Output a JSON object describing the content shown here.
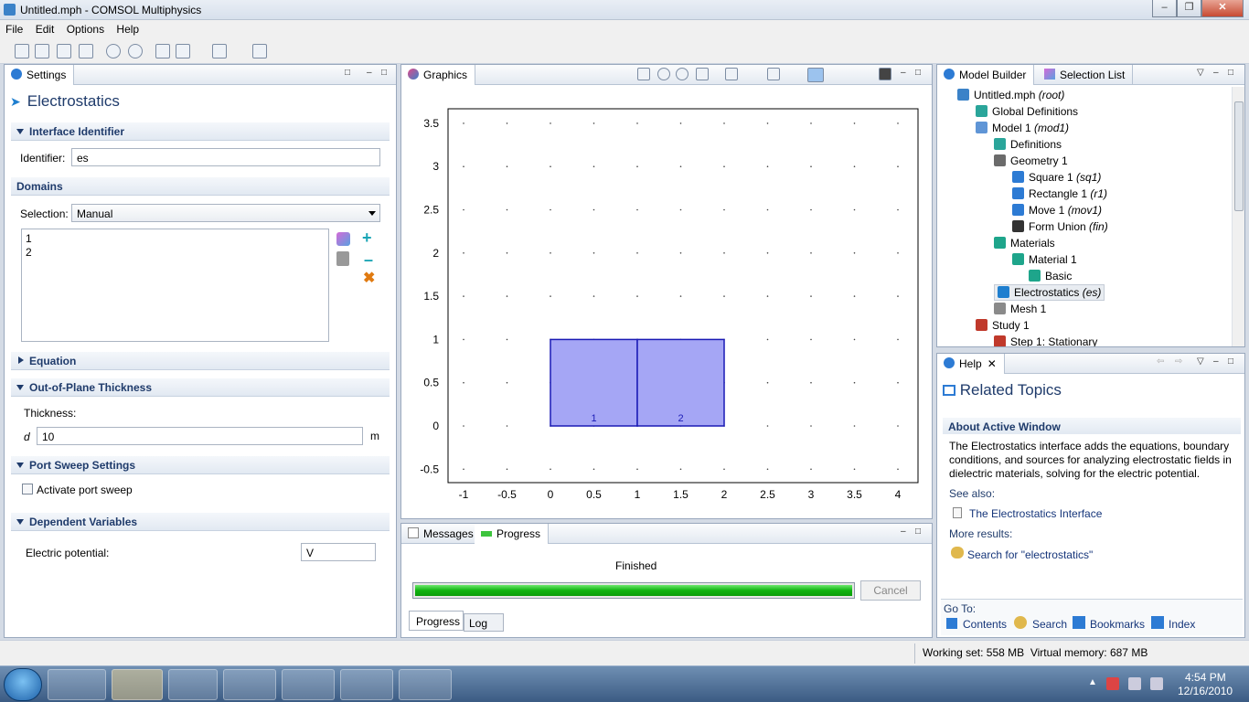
{
  "window": {
    "title": "Untitled.mph - COMSOL Multiphysics"
  },
  "menu": [
    "File",
    "Edit",
    "Options",
    "Help"
  ],
  "settings": {
    "tab_label": "Settings",
    "heading": "Electrostatics",
    "interface_identifier": {
      "title": "Interface Identifier",
      "label": "Identifier:",
      "value": "es"
    },
    "domains": {
      "title": "Domains",
      "selection_label": "Selection:",
      "selection_value": "Manual",
      "items": [
        "1",
        "2"
      ]
    },
    "equation": {
      "title": "Equation"
    },
    "thickness": {
      "title": "Out-of-Plane Thickness",
      "label": "Thickness:",
      "symbol": "d",
      "value": "10",
      "unit": "m"
    },
    "port_sweep": {
      "title": "Port Sweep Settings",
      "checkbox_label": "Activate port sweep"
    },
    "dependent": {
      "title": "Dependent Variables",
      "label": "Electric potential:",
      "value": "V"
    }
  },
  "graphics": {
    "tab_label": "Graphics",
    "x_ticks": [
      "-1",
      "-0.5",
      "0",
      "0.5",
      "1",
      "1.5",
      "2",
      "2.5",
      "3",
      "3.5",
      "4"
    ],
    "y_ticks": [
      "3.5",
      "3",
      "2.5",
      "2",
      "1.5",
      "1",
      "0.5",
      "0",
      "-0.5"
    ],
    "domain_labels": [
      "1",
      "2"
    ],
    "fill_color": "#a5a6f5",
    "edge_color": "#1a1ab5"
  },
  "messages": {
    "tabs": [
      "Messages",
      "Progress"
    ],
    "status": "Finished",
    "progress": 1.0,
    "cancel_label": "Cancel",
    "bottom_tabs": [
      "Progress",
      "Log"
    ]
  },
  "model_builder": {
    "tabs": [
      "Model Builder",
      "Selection List"
    ],
    "items": [
      {
        "label": "Untitled.mph",
        "extra": "(root)",
        "icon": "root-icon",
        "color": "#3b82c8"
      },
      {
        "label": "Global Definitions",
        "extra": "",
        "icon": "global-definitions-icon",
        "color": "#2aa59a"
      },
      {
        "label": "Model 1",
        "extra": "(mod1)",
        "icon": "model-icon",
        "color": "#5f95d6"
      },
      {
        "label": "Definitions",
        "extra": "",
        "icon": "definitions-icon",
        "color": "#2aa59a"
      },
      {
        "label": "Geometry 1",
        "extra": "",
        "icon": "geometry-icon",
        "color": "#6b6b6b"
      },
      {
        "label": "Square 1",
        "extra": "(sq1)",
        "icon": "square-icon",
        "color": "#2d7bd4"
      },
      {
        "label": "Rectangle 1",
        "extra": "(r1)",
        "icon": "rectangle-icon",
        "color": "#2d7bd4"
      },
      {
        "label": "Move 1",
        "extra": "(mov1)",
        "icon": "move-icon",
        "color": "#2d7bd4"
      },
      {
        "label": "Form Union",
        "extra": "(fin)",
        "icon": "form-union-icon",
        "color": "#333333"
      },
      {
        "label": "Materials",
        "extra": "",
        "icon": "materials-icon",
        "color": "#1ea58b"
      },
      {
        "label": "Material 1",
        "extra": "",
        "icon": "material-icon",
        "color": "#1ea58b"
      },
      {
        "label": "Basic",
        "extra": "",
        "icon": "basic-icon",
        "color": "#1ea58b"
      },
      {
        "label": "Electrostatics",
        "extra": "(es)",
        "icon": "electrostatics-icon",
        "color": "#1f7fcf"
      },
      {
        "label": "Mesh 1",
        "extra": "",
        "icon": "mesh-icon",
        "color": "#8a8a8a"
      },
      {
        "label": "Study 1",
        "extra": "",
        "icon": "study-icon",
        "color": "#c0392b"
      },
      {
        "label": "Step 1: Stationary",
        "extra": "",
        "icon": "step-icon",
        "color": "#c0392b"
      }
    ]
  },
  "help": {
    "tab_label": "Help",
    "heading": "Related Topics",
    "section_title": "About Active Window",
    "body": "The Electrostatics interface adds the equations, boundary conditions, and sources for analyzing electrostatic fields in dielectric materials, solving for the electric potential.",
    "see_also": "See also:",
    "link1": "The Electrostatics Interface",
    "more_results": "More results:",
    "link2": "Search for \"electrostatics\"",
    "goto": "Go To:",
    "goto_links": [
      "Contents",
      "Search",
      "Bookmarks",
      "Index"
    ]
  },
  "status": {
    "text": "Working set: 558 MB  Virtual memory: 687 MB"
  },
  "clock": {
    "time": "4:54 PM",
    "date": "12/16/2010"
  }
}
